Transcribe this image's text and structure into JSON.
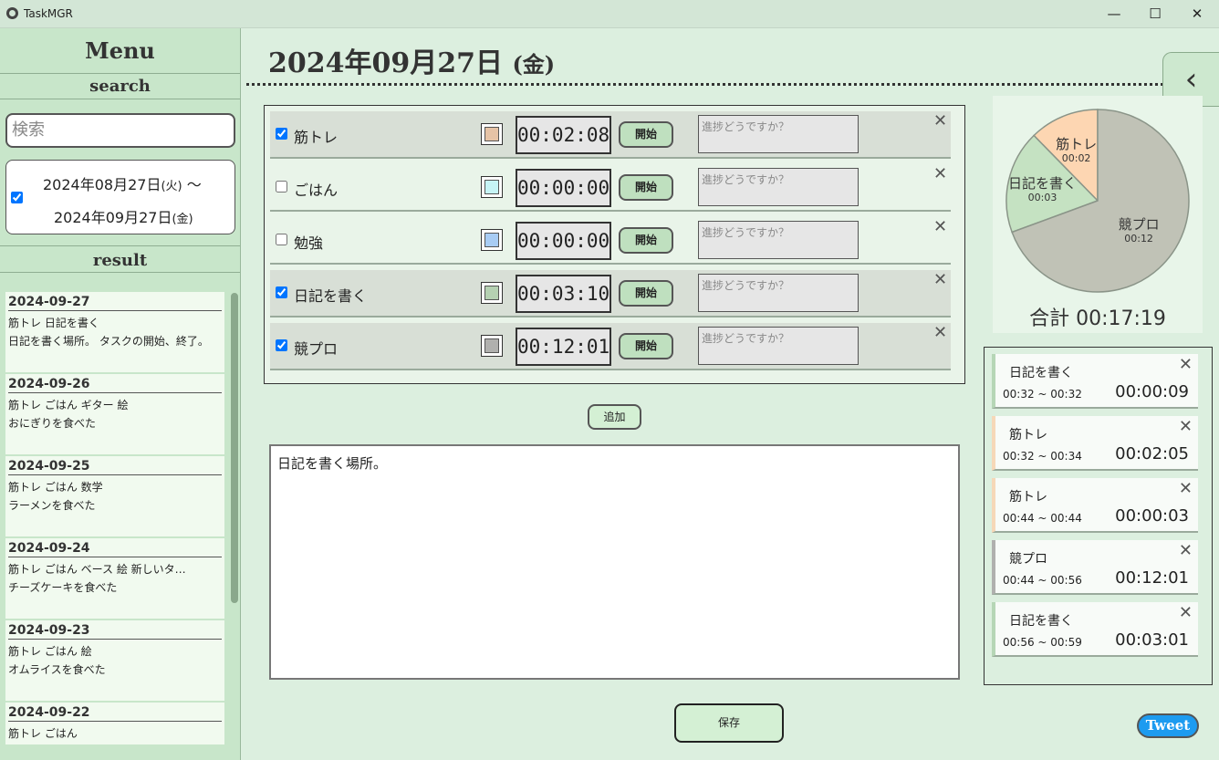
{
  "window": {
    "title": "TaskMGR",
    "minimize": "—",
    "maximize": "☐",
    "close": "✕"
  },
  "sidebar": {
    "menu_title": "Menu",
    "search_title": "search",
    "search_placeholder": "検索",
    "date_range": {
      "checked": true,
      "from": "2024年08月27日",
      "from_dow": "(火)",
      "sep": "～",
      "to": "2024年09月27日",
      "to_dow": "(金)"
    },
    "result_title": "result",
    "results": [
      {
        "date": "2024-09-27",
        "tasks": "筋トレ 日記を書く",
        "note": "日記を書く場所。 タスクの開始、終了。"
      },
      {
        "date": "2024-09-26",
        "tasks": "筋トレ ごはん ギター 絵",
        "note": "おにぎりを食べた"
      },
      {
        "date": "2024-09-25",
        "tasks": "筋トレ ごはん 数学",
        "note": "ラーメンを食べた"
      },
      {
        "date": "2024-09-24",
        "tasks": "筋トレ ごはん ベース 絵 新しいタ…",
        "note": "チーズケーキを食べた"
      },
      {
        "date": "2024-09-23",
        "tasks": "筋トレ ごはん 絵",
        "note": "オムライスを食べた"
      },
      {
        "date": "2024-09-22",
        "tasks": "筋トレ ごはん",
        "note": ""
      }
    ]
  },
  "main": {
    "date": "2024年09月27日",
    "dow": "(金)",
    "collapse_icon": "‹",
    "tasks": [
      {
        "name": "筋トレ",
        "checked": true,
        "color": "#e6c3a6",
        "time": "00:02:08",
        "start_label": "開始",
        "progress_placeholder": "進捗どうですか？",
        "close": "✕"
      },
      {
        "name": "ごはん",
        "checked": false,
        "color": "#c6f4f6",
        "time": "00:00:00",
        "start_label": "開始",
        "progress_placeholder": "進捗どうですか？",
        "close": "✕"
      },
      {
        "name": "勉強",
        "checked": false,
        "color": "#a8ccf4",
        "time": "00:00:00",
        "start_label": "開始",
        "progress_placeholder": "進捗どうですか？",
        "close": "✕"
      },
      {
        "name": "日記を書く",
        "checked": true,
        "color": "#b5d1b2",
        "time": "00:03:10",
        "start_label": "開始",
        "progress_placeholder": "進捗どうですか？",
        "close": "✕"
      },
      {
        "name": "競プロ",
        "checked": true,
        "color": "#b0b0ae",
        "time": "00:12:01",
        "start_label": "開始",
        "progress_placeholder": "進捗どうですか？",
        "close": "✕"
      }
    ],
    "add_label": "追加",
    "diary_text": "日記を書く場所。",
    "save_label": "保存"
  },
  "chart_data": {
    "type": "pie",
    "slices": [
      {
        "label": "筋トレ",
        "value_label": "00:02",
        "seconds": 128,
        "color": "#fdd6b2"
      },
      {
        "label": "日記を書く",
        "value_label": "00:03",
        "seconds": 190,
        "color": "#c5e2c2"
      },
      {
        "label": "競プロ",
        "value_label": "00:12",
        "seconds": 721,
        "color": "#c0c2b6"
      }
    ],
    "total_label": "合計 00:17:19"
  },
  "log": [
    {
      "name": "日記を書く",
      "range": "00:32 ~ 00:32",
      "duration": "00:00:09",
      "accent": "#b6d6b6",
      "close": "✕"
    },
    {
      "name": "筋トレ",
      "range": "00:32 ~ 00:34",
      "duration": "00:02:05",
      "accent": "#f6d8b8",
      "close": "✕"
    },
    {
      "name": "筋トレ",
      "range": "00:44 ~ 00:44",
      "duration": "00:00:03",
      "accent": "#f6d8b8",
      "close": "✕"
    },
    {
      "name": "競プロ",
      "range": "00:44 ~ 00:56",
      "duration": "00:12:01",
      "accent": "#b0b0ae",
      "close": "✕"
    },
    {
      "name": "日記を書く",
      "range": "00:56 ~ 00:59",
      "duration": "00:03:01",
      "accent": "#b6d6b6",
      "close": "✕"
    }
  ],
  "tweet_label": "Tweet"
}
